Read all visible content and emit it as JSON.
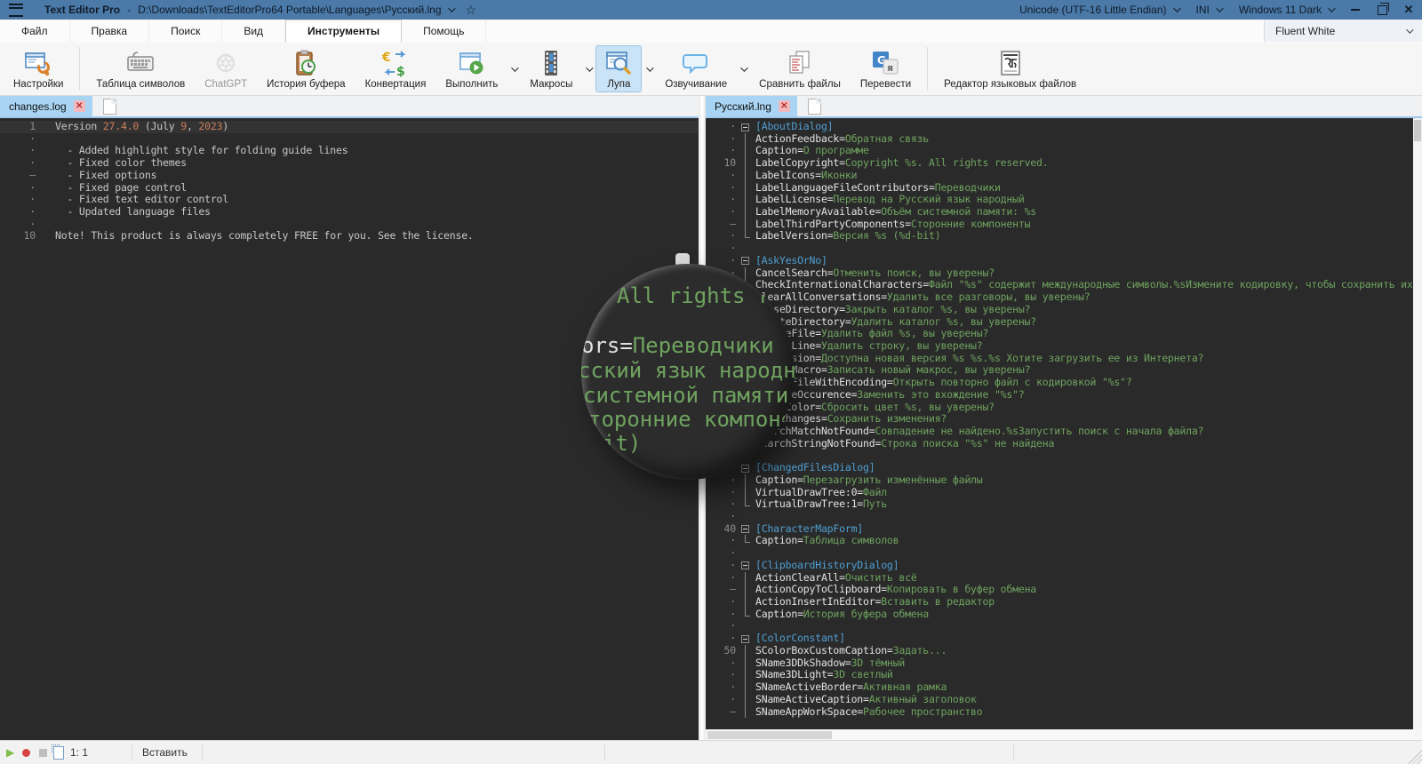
{
  "window": {
    "app_title": "Text Editor Pro",
    "title_separator": "-",
    "file_path": "D:\\Downloads\\TextEditorPro64 Portable\\Languages\\Русский.lng",
    "encoding": "Unicode (UTF-16 Little Endian)",
    "file_type": "INI",
    "os_theme": "Windows 11 Dark"
  },
  "menu": {
    "items": [
      {
        "label": "Файл"
      },
      {
        "label": "Правка"
      },
      {
        "label": "Поиск"
      },
      {
        "label": "Вид"
      },
      {
        "label": "Инструменты",
        "active": true
      },
      {
        "label": "Помощь"
      }
    ],
    "style_selector": "Fluent White"
  },
  "toolbar": {
    "buttons": [
      {
        "label": "Настройки",
        "icon": "settings-icon"
      },
      {
        "sep": true
      },
      {
        "label": "Таблица символов",
        "icon": "character-map-icon"
      },
      {
        "label": "ChatGPT",
        "icon": "chatgpt-icon",
        "disabled": true
      },
      {
        "label": "История буфера",
        "icon": "clipboard-history-icon"
      },
      {
        "label": "Конвертация",
        "icon": "convert-icon"
      },
      {
        "label": "Выполнить",
        "icon": "run-icon",
        "dropdown": true
      },
      {
        "label": "Макросы",
        "icon": "macros-icon",
        "dropdown": true
      },
      {
        "label": "Лупа",
        "icon": "magnifier-icon",
        "dropdown": true,
        "active": true
      },
      {
        "label": "Озвучивание",
        "icon": "speech-icon",
        "dropdown": true
      },
      {
        "label": "Сравнить файлы",
        "icon": "compare-files-icon"
      },
      {
        "label": "Перевести",
        "icon": "translate-icon"
      },
      {
        "sep": true
      },
      {
        "label": "Редактор языковых файлов",
        "icon": "language-file-editor-icon"
      }
    ]
  },
  "left_pane": {
    "tab": "changes.log",
    "lines": [
      {
        "g": "1",
        "cur": true,
        "s": [
          [
            "txt",
            "Version "
          ],
          [
            "num",
            "27.4.0"
          ],
          [
            "txt",
            " (July "
          ],
          [
            "num",
            "9"
          ],
          [
            "txt",
            ", "
          ],
          [
            "num",
            "2023"
          ],
          [
            "txt",
            ")"
          ]
        ]
      },
      {
        "g": "·",
        "s": []
      },
      {
        "g": "·",
        "s": [
          [
            "txt",
            "  - Added highlight style for folding guide lines"
          ]
        ]
      },
      {
        "g": "·",
        "s": [
          [
            "txt",
            "  - Fixed color themes"
          ]
        ]
      },
      {
        "g": "–",
        "s": [
          [
            "txt",
            "  - Fixed options"
          ]
        ]
      },
      {
        "g": "·",
        "s": [
          [
            "txt",
            "  - Fixed page control"
          ]
        ]
      },
      {
        "g": "·",
        "s": [
          [
            "txt",
            "  - Fixed text editor control"
          ]
        ]
      },
      {
        "g": "·",
        "s": [
          [
            "txt",
            "  - Updated language files"
          ]
        ]
      },
      {
        "g": "·",
        "s": []
      },
      {
        "g": "10",
        "s": [
          [
            "txt",
            "Note! This product is always completely FREE for you. See the license."
          ]
        ]
      }
    ]
  },
  "right_pane": {
    "tab": "Русский.lng",
    "lines": [
      {
        "g": "·",
        "f": "box",
        "s": [
          [
            "sec",
            "[AboutDialog]"
          ]
        ]
      },
      {
        "g": "·",
        "f": "mid",
        "s": [
          [
            "key",
            "ActionFeedback="
          ],
          [
            "val",
            "Обратная связь"
          ]
        ]
      },
      {
        "g": "·",
        "f": "mid",
        "s": [
          [
            "key",
            "Caption="
          ],
          [
            "val",
            "О программе"
          ]
        ]
      },
      {
        "g": "10",
        "f": "mid",
        "s": [
          [
            "key",
            "LabelCopyright="
          ],
          [
            "val",
            "Copyright %s. All rights reserved."
          ]
        ]
      },
      {
        "g": "·",
        "f": "mid",
        "s": [
          [
            "key",
            "LabelIcons="
          ],
          [
            "val",
            "Иконки"
          ]
        ]
      },
      {
        "g": "·",
        "f": "mid",
        "s": [
          [
            "key",
            "LabelLanguageFileContributors="
          ],
          [
            "val",
            "Переводчики"
          ]
        ]
      },
      {
        "g": "·",
        "f": "mid",
        "s": [
          [
            "key",
            "LabelLicense="
          ],
          [
            "val",
            "Перевод на Русский язык народный"
          ]
        ]
      },
      {
        "g": "·",
        "f": "mid",
        "s": [
          [
            "key",
            "LabelMemoryAvailable="
          ],
          [
            "val",
            "Объём системной памяти: %s"
          ]
        ]
      },
      {
        "g": "–",
        "f": "mid",
        "s": [
          [
            "key",
            "LabelThirdPartyComponents="
          ],
          [
            "val",
            "Сторонние компоненты"
          ]
        ]
      },
      {
        "g": "·",
        "f": "end",
        "s": [
          [
            "key",
            "LabelVersion="
          ],
          [
            "val",
            "Версия %s (%d-bit)"
          ]
        ]
      },
      {
        "g": "·",
        "f": "",
        "s": []
      },
      {
        "g": "·",
        "f": "box",
        "s": [
          [
            "sec",
            "[AskYesOrNo]"
          ]
        ]
      },
      {
        "g": "·",
        "f": "mid",
        "s": [
          [
            "key",
            "CancelSearch="
          ],
          [
            "val",
            "Отменить поиск, вы уверены?"
          ]
        ]
      },
      {
        "g": "20",
        "f": "mid",
        "s": [
          [
            "key",
            "CheckInternationalCharacters="
          ],
          [
            "val",
            "Файл \"%s\" содержит международные символы.%sИзмените кодировку, чтобы сохранить их."
          ]
        ]
      },
      {
        "g": "·",
        "f": "mid",
        "s": [
          [
            "key",
            "ClearAllConversations="
          ],
          [
            "val",
            "Удалить все разговоры, вы уверены?"
          ]
        ]
      },
      {
        "g": "·",
        "f": "mid",
        "s": [
          [
            "key",
            "CloseDirectory="
          ],
          [
            "val",
            "Закрыть каталог %s, вы уверены?"
          ]
        ]
      },
      {
        "g": "·",
        "f": "mid",
        "s": [
          [
            "key",
            "DeleteDirectory="
          ],
          [
            "val",
            "Удалить каталог %s, вы уверены?"
          ]
        ]
      },
      {
        "g": "·",
        "f": "mid",
        "s": [
          [
            "key",
            "DeleteFile="
          ],
          [
            "val",
            "Удалить файл %s, вы уверены?"
          ]
        ]
      },
      {
        "g": "–",
        "f": "mid",
        "s": [
          [
            "key",
            "DeleteLine="
          ],
          [
            "val",
            "Удалить строку, вы уверены?"
          ]
        ]
      },
      {
        "g": "·",
        "f": "mid",
        "s": [
          [
            "key",
            "NewVersion="
          ],
          [
            "val",
            "Доступна новая версия %s %s.%s Хотите загрузить ее из Интернета?"
          ]
        ]
      },
      {
        "g": "·",
        "f": "mid",
        "s": [
          [
            "key",
            "RecordMacro="
          ],
          [
            "val",
            "Записать новый макрос, вы уверены?"
          ]
        ]
      },
      {
        "g": "·",
        "f": "mid",
        "s": [
          [
            "key",
            "ReopenFileWithEncoding="
          ],
          [
            "val",
            "Открыть повторно файл с кодировкой \"%s\"?"
          ]
        ]
      },
      {
        "g": "·",
        "f": "mid",
        "s": [
          [
            "key",
            "ReplaceOccurence="
          ],
          [
            "val",
            "Заменить это вхождение \"%s\"?"
          ]
        ]
      },
      {
        "g": "30",
        "f": "mid",
        "s": [
          [
            "key",
            "ResetColor="
          ],
          [
            "val",
            "Сбросить цвет %s, вы уверены?"
          ]
        ]
      },
      {
        "g": "·",
        "f": "mid",
        "s": [
          [
            "key",
            "SaveChanges="
          ],
          [
            "val",
            "Сохранить изменения?"
          ]
        ]
      },
      {
        "g": "·",
        "f": "mid",
        "s": [
          [
            "key",
            "SearchMatchNotFound="
          ],
          [
            "val",
            "Совпадение не найдено.%sЗапустить поиск с начала файла?"
          ]
        ]
      },
      {
        "g": "·",
        "f": "end",
        "s": [
          [
            "key",
            "SearchStringNotFound="
          ],
          [
            "val",
            "Строка поиска \"%s\" не найдена"
          ]
        ]
      },
      {
        "g": "·",
        "f": "",
        "s": []
      },
      {
        "g": "–",
        "f": "box",
        "s": [
          [
            "sec",
            "[ChangedFilesDialog]"
          ]
        ]
      },
      {
        "g": "·",
        "f": "mid",
        "s": [
          [
            "key",
            "Caption="
          ],
          [
            "val",
            "Перезагрузить изменённые файлы"
          ]
        ]
      },
      {
        "g": "·",
        "f": "mid",
        "s": [
          [
            "key",
            "VirtualDrawTree:0="
          ],
          [
            "val",
            "Файл"
          ]
        ]
      },
      {
        "g": "·",
        "f": "end",
        "s": [
          [
            "key",
            "VirtualDrawTree:1="
          ],
          [
            "val",
            "Путь"
          ]
        ]
      },
      {
        "g": "·",
        "f": "",
        "s": []
      },
      {
        "g": "40",
        "f": "box",
        "s": [
          [
            "sec",
            "[CharacterMapForm]"
          ]
        ]
      },
      {
        "g": "·",
        "f": "end",
        "s": [
          [
            "key",
            "Caption="
          ],
          [
            "val",
            "Таблица символов"
          ]
        ]
      },
      {
        "g": "·",
        "f": "",
        "s": []
      },
      {
        "g": "·",
        "f": "box",
        "s": [
          [
            "sec",
            "[ClipboardHistoryDialog]"
          ]
        ]
      },
      {
        "g": "·",
        "f": "mid",
        "s": [
          [
            "key",
            "ActionClearAll="
          ],
          [
            "val",
            "Очистить всё"
          ]
        ]
      },
      {
        "g": "–",
        "f": "mid",
        "s": [
          [
            "key",
            "ActionCopyToClipboard="
          ],
          [
            "val",
            "Копировать в буфер обмена"
          ]
        ]
      },
      {
        "g": "·",
        "f": "mid",
        "s": [
          [
            "key",
            "ActionInsertInEditor="
          ],
          [
            "val",
            "Вставить в редактор"
          ]
        ]
      },
      {
        "g": "·",
        "f": "end",
        "s": [
          [
            "key",
            "Caption="
          ],
          [
            "val",
            "История буфера обмена"
          ]
        ]
      },
      {
        "g": "·",
        "f": "",
        "s": []
      },
      {
        "g": "·",
        "f": "box",
        "s": [
          [
            "sec",
            "[ColorConstant]"
          ]
        ]
      },
      {
        "g": "50",
        "f": "mid",
        "s": [
          [
            "key",
            "SColorBoxCustomCaption="
          ],
          [
            "val",
            "Задать..."
          ]
        ]
      },
      {
        "g": "·",
        "f": "mid",
        "s": [
          [
            "key",
            "SName3DDkShadow="
          ],
          [
            "val",
            "3D тёмный"
          ]
        ]
      },
      {
        "g": "·",
        "f": "mid",
        "s": [
          [
            "key",
            "SName3DLight="
          ],
          [
            "val",
            "3D светлый"
          ]
        ]
      },
      {
        "g": "·",
        "f": "mid",
        "s": [
          [
            "key",
            "SNameActiveBorder="
          ],
          [
            "val",
            "Активная рамка"
          ]
        ]
      },
      {
        "g": "·",
        "f": "mid",
        "s": [
          [
            "key",
            "SNameActiveCaption="
          ],
          [
            "val",
            "Активный заголовок"
          ]
        ]
      },
      {
        "g": "–",
        "f": "mid",
        "s": [
          [
            "key",
            "SNameAppWorkSpace="
          ],
          [
            "val",
            "Рабочее пространство"
          ]
        ]
      }
    ]
  },
  "loupe": {
    "lines": [
      {
        "s": [
          [
            "val",
            "All rights re"
          ]
        ]
      },
      {
        "s": [
          [
            "key",
            "ors="
          ],
          [
            "val",
            "Переводчики"
          ]
        ]
      },
      {
        "s": [
          [
            "val",
            "сский язык народный"
          ]
        ]
      },
      {
        "s": [
          [
            "val",
            "системной памяти:"
          ]
        ]
      },
      {
        "s": [
          [
            "val",
            "торонние компоненты"
          ]
        ]
      },
      {
        "s": [
          [
            "val",
            "it)"
          ]
        ]
      }
    ]
  },
  "status_bar": {
    "caret": "1: 1",
    "mode": "Вставить"
  },
  "colors": {
    "titlebar": "#4b79a8",
    "tab_active": "#a9d4f3",
    "editor_bg": "#2a2a2a",
    "section_blue": "#4f9fd3",
    "value_green": "#6fa35f",
    "number_orange": "#cd7e5a"
  }
}
